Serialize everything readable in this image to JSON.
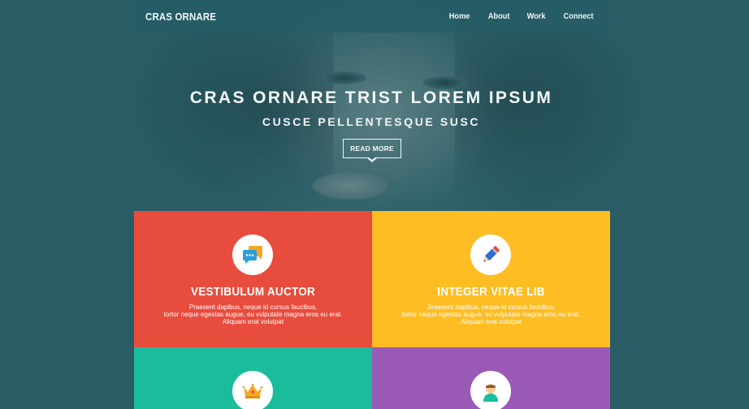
{
  "colors": {
    "hero_tint": "#2a5c66",
    "feature_red": "#e84c3d",
    "feature_yellow": "#fdbd23",
    "feature_teal": "#1abc9c",
    "feature_purple": "#9b59b6"
  },
  "navbar": {
    "brand": "CRAS ORNARE",
    "links": [
      {
        "label": "Home"
      },
      {
        "label": "About"
      },
      {
        "label": "Work"
      },
      {
        "label": "Connect"
      }
    ]
  },
  "hero": {
    "title": "CRAS ORNARE TRIST LOREM IPSUM",
    "subtitle": "CUSCE PELLENTESQUE SUSC",
    "button_label": "READ MORE"
  },
  "features": [
    {
      "icon": "chat-bubbles-icon",
      "title": "VESTIBULUM AUCTOR",
      "desc_lines": [
        "Praesent dapibus, neque id cursus faucibus,",
        "tortor neque egestas augue, eu vulputate magna eros eu erat.",
        "Aliquam erat volutpat"
      ]
    },
    {
      "icon": "pencil-icon",
      "title": "INTEGER VITAE LIB",
      "desc_lines": [
        "Jiraesent dapibus, neque id cursus faucibus,",
        "tortor neque egestas augue, eu vulputate magna eros eu erat.",
        "Aliquam erat volutpat"
      ]
    },
    {
      "icon": "crown-icon"
    },
    {
      "icon": "person-icon"
    }
  ]
}
